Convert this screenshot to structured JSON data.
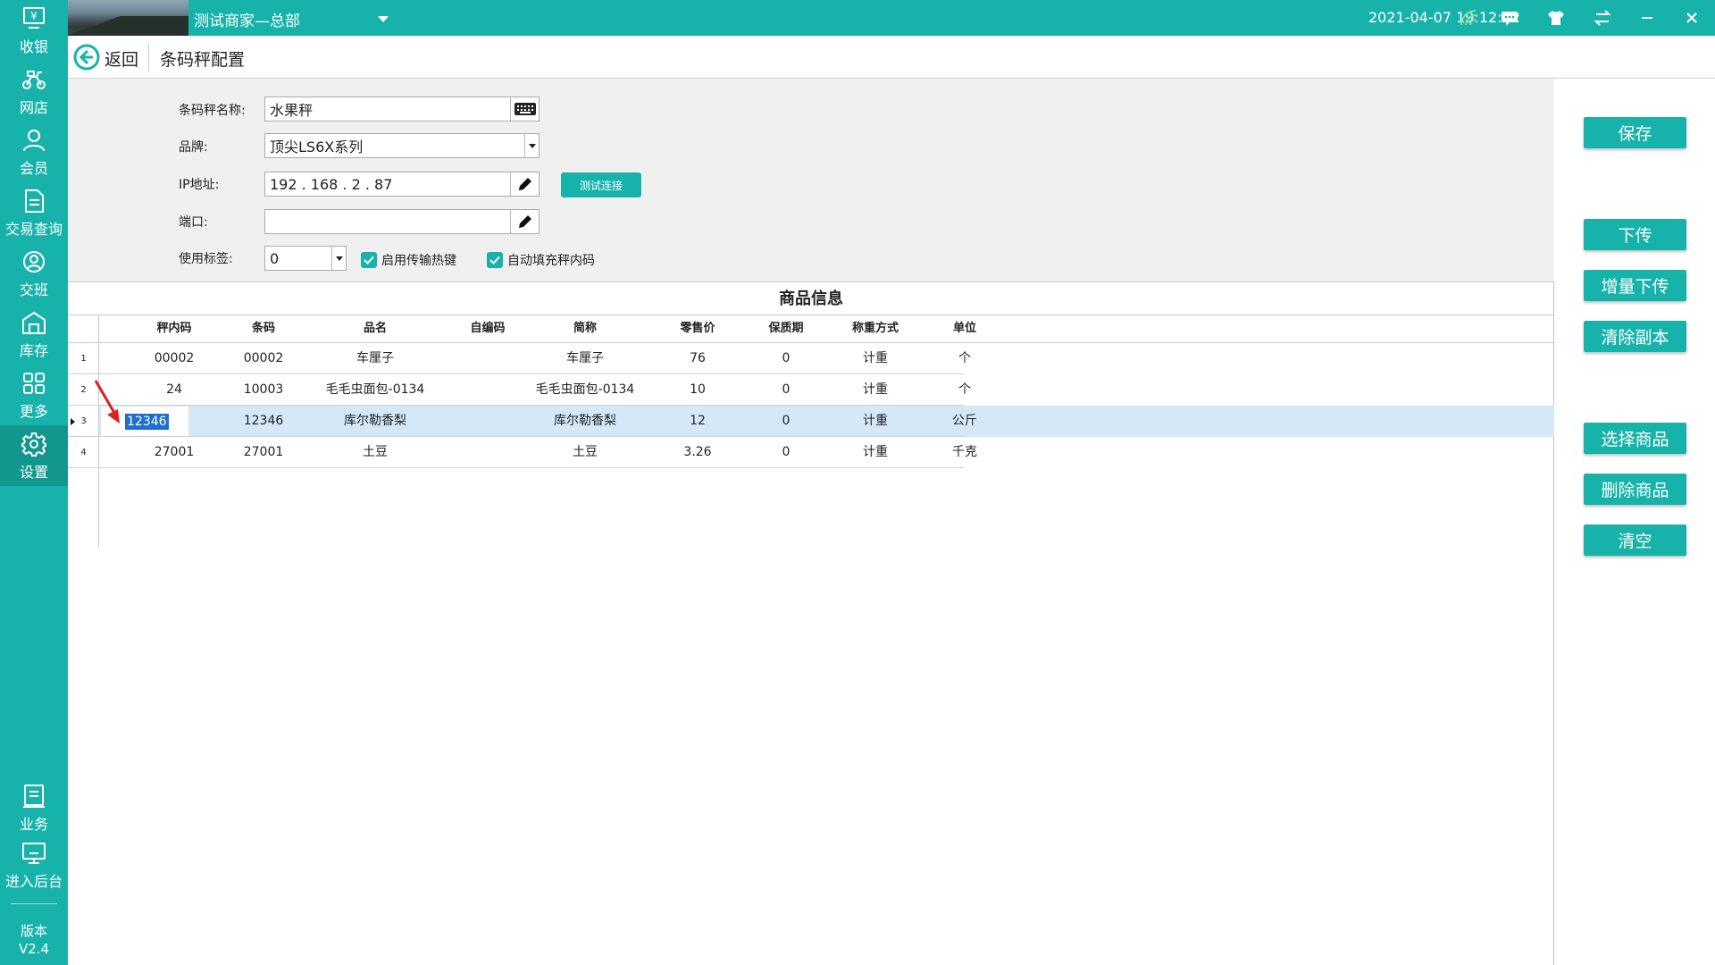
{
  "sidebar": {
    "items": [
      {
        "label": "收银",
        "icon": "cashier-icon"
      },
      {
        "label": "网店",
        "icon": "bike-icon"
      },
      {
        "label": "会员",
        "icon": "user-icon"
      },
      {
        "label": "交易查询",
        "icon": "document-icon"
      },
      {
        "label": "交班",
        "icon": "shift-icon"
      },
      {
        "label": "库存",
        "icon": "warehouse-icon"
      },
      {
        "label": "更多",
        "icon": "grid-icon"
      },
      {
        "label": "设置",
        "icon": "gear-icon"
      }
    ],
    "bottom_items": [
      {
        "label": "业务",
        "icon": "clipboard-icon"
      },
      {
        "label": "进入后台",
        "icon": "monitor-icon"
      }
    ],
    "version_label": "版本",
    "version_value": "V2.4"
  },
  "topbar": {
    "store_name": "测试商家—总部",
    "datetime": "2021-04-07 19:12:12"
  },
  "header": {
    "back_label": "返回",
    "title": "条码秤配置"
  },
  "form": {
    "name_label": "条码秤名称:",
    "name_value": "水果秤",
    "brand_label": "品牌:",
    "brand_value": "顶尖LS6X系列",
    "ip_label": "IP地址:",
    "ip_value": "192 . 168 . 2 . 87",
    "test_button": "测试连接",
    "port_label": "端口:",
    "port_value": "",
    "tag_label": "使用标签:",
    "tag_value": "0",
    "hotkey_checkbox": "启用传输热键",
    "autofill_checkbox": "自动填充秤内码"
  },
  "table": {
    "caption": "商品信息",
    "columns": [
      "秤内码",
      "条码",
      "品名",
      "自编码",
      "简称",
      "零售价",
      "保质期",
      "称重方式",
      "单位"
    ],
    "rows": [
      {
        "num": "1",
        "cells": [
          "00002",
          "00002",
          "车厘子",
          "",
          "车厘子",
          "76",
          "0",
          "计重",
          "个"
        ]
      },
      {
        "num": "2",
        "cells": [
          "24",
          "10003",
          "毛毛虫面包-0134",
          "",
          "毛毛虫面包-0134",
          "10",
          "0",
          "计重",
          "个"
        ]
      },
      {
        "num": "3",
        "cells": [
          "12346",
          "12346",
          "库尔勒香梨",
          "",
          "库尔勒香梨",
          "12",
          "0",
          "计重",
          "公斤"
        ]
      },
      {
        "num": "4",
        "cells": [
          "27001",
          "27001",
          "土豆",
          "",
          "土豆",
          "3.26",
          "0",
          "计重",
          "千克"
        ]
      }
    ],
    "selected_row": 3
  },
  "actions": {
    "save": "保存",
    "upload": "下传",
    "incremental_upload": "增量下传",
    "clear_copy": "清除副本",
    "select_product": "选择商品",
    "delete_product": "删除商品",
    "clear": "清空"
  },
  "colors": {
    "brand": "#17b3ab",
    "selection_row": "#d5e8f8",
    "text_highlight": "#1e6fd0",
    "annotation_arrow": "#e02020"
  }
}
